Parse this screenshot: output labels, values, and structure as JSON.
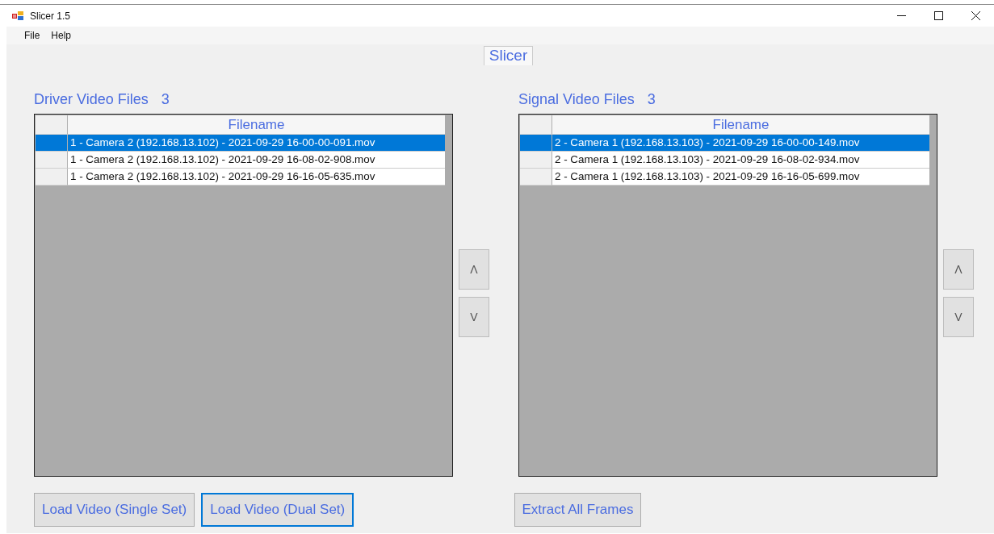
{
  "window": {
    "title": "Slicer 1.5"
  },
  "menu": [
    "File",
    "Help"
  ],
  "tab": {
    "label": "Slicer",
    "selected": true
  },
  "panels": [
    {
      "title": "Driver Video Files",
      "count": "3",
      "column": "Filename",
      "rows": [
        {
          "filename": "1 - Camera 2 (192.168.13.102) - 2021-09-29 16-00-00-091.mov",
          "selected": true
        },
        {
          "filename": "1 - Camera 2 (192.168.13.102) - 2021-09-29 16-08-02-908.mov",
          "selected": false
        },
        {
          "filename": "1 - Camera 2 (192.168.13.102) - 2021-09-29 16-16-05-635.mov",
          "selected": false
        }
      ],
      "move_buttons": [
        "Λ",
        "V"
      ]
    },
    {
      "title": "Signal Video Files",
      "count": "3",
      "column": "Filename",
      "rows": [
        {
          "filename": "2 - Camera 1 (192.168.13.103) - 2021-09-29 16-00-00-149.mov",
          "selected": true
        },
        {
          "filename": "2 - Camera 1 (192.168.13.103) - 2021-09-29 16-08-02-934.mov",
          "selected": false
        },
        {
          "filename": "2 - Camera 1 (192.168.13.103) - 2021-09-29 16-16-05-699.mov",
          "selected": false
        }
      ],
      "move_buttons": [
        "Λ",
        "V"
      ]
    }
  ],
  "left_buttons": [
    {
      "label": "Load Video (Single Set)",
      "focused": false
    },
    {
      "label": "Load Video (Dual Set)",
      "focused": true
    }
  ],
  "right_buttons": [
    {
      "label": "Extract All Frames",
      "focused": false
    }
  ]
}
